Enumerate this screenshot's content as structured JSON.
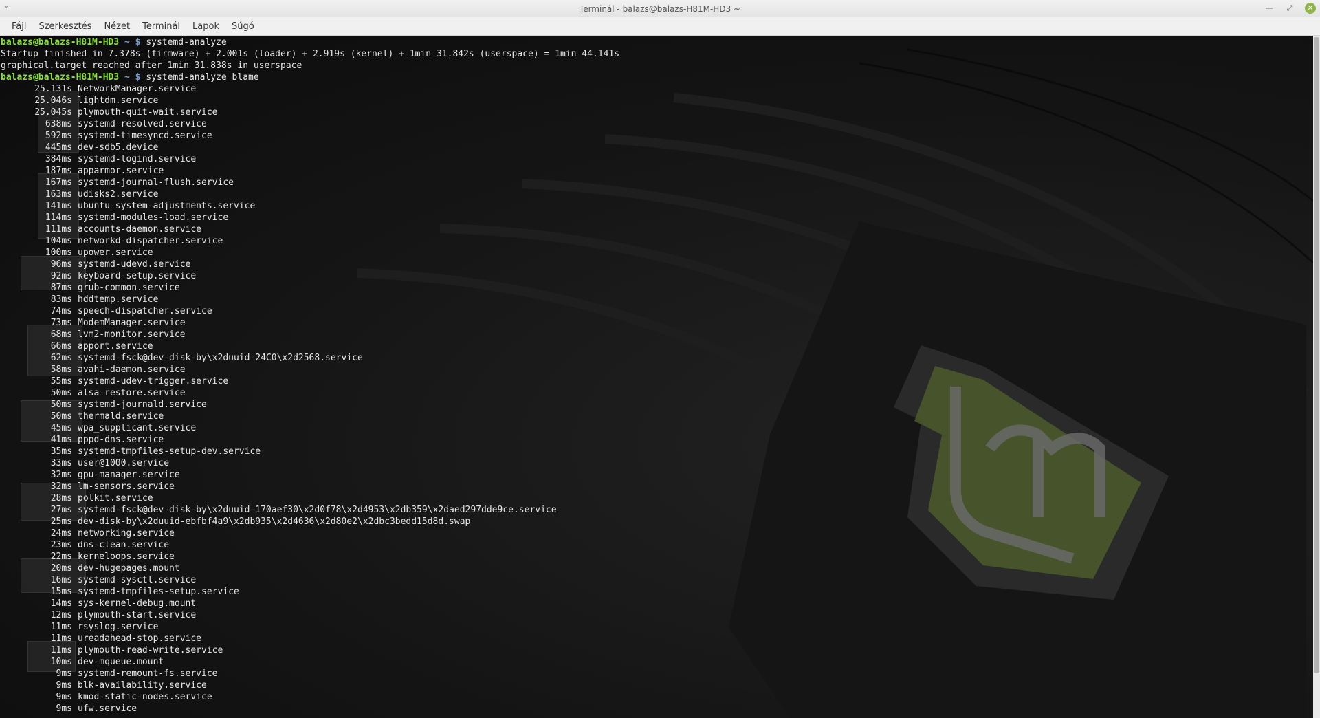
{
  "window": {
    "title": "Terminál - balazs@balazs-H81M-HD3 ~",
    "menu_toggle_icon": "chevron-down-icon",
    "controls": {
      "minimize_icon": "minimize-icon",
      "maximize_icon": "maximize-icon",
      "close_icon": "close-icon"
    }
  },
  "menu": [
    "Fájl",
    "Szerkesztés",
    "Nézet",
    "Terminál",
    "Lapok",
    "Súgó"
  ],
  "colors": {
    "prompt_user": "#8ae234",
    "prompt_path": "#729fcf",
    "text": "#e6e6e6",
    "close_button": "#8fb54a"
  },
  "terminal": {
    "commands": [
      {
        "user": "balazs@balazs-H81M-HD3",
        "path": "~ $",
        "cmd": "systemd-analyze"
      },
      {
        "user": "balazs@balazs-H81M-HD3",
        "path": "~ $",
        "cmd": "systemd-analyze blame"
      }
    ],
    "analyze_output": [
      "Startup finished in 7.378s (firmware) + 2.001s (loader) + 2.919s (kernel) + 1min 31.842s (userspace) = 1min 44.141s",
      "graphical.target reached after 1min 31.838s in userspace"
    ],
    "blame": [
      [
        "25.131s",
        "NetworkManager.service"
      ],
      [
        "25.046s",
        "lightdm.service"
      ],
      [
        "25.045s",
        "plymouth-quit-wait.service"
      ],
      [
        "638ms",
        "systemd-resolved.service"
      ],
      [
        "592ms",
        "systemd-timesyncd.service"
      ],
      [
        "445ms",
        "dev-sdb5.device"
      ],
      [
        "384ms",
        "systemd-logind.service"
      ],
      [
        "187ms",
        "apparmor.service"
      ],
      [
        "167ms",
        "systemd-journal-flush.service"
      ],
      [
        "163ms",
        "udisks2.service"
      ],
      [
        "141ms",
        "ubuntu-system-adjustments.service"
      ],
      [
        "114ms",
        "systemd-modules-load.service"
      ],
      [
        "111ms",
        "accounts-daemon.service"
      ],
      [
        "104ms",
        "networkd-dispatcher.service"
      ],
      [
        "100ms",
        "upower.service"
      ],
      [
        "96ms",
        "systemd-udevd.service"
      ],
      [
        "92ms",
        "keyboard-setup.service"
      ],
      [
        "87ms",
        "grub-common.service"
      ],
      [
        "83ms",
        "hddtemp.service"
      ],
      [
        "74ms",
        "speech-dispatcher.service"
      ],
      [
        "73ms",
        "ModemManager.service"
      ],
      [
        "68ms",
        "lvm2-monitor.service"
      ],
      [
        "66ms",
        "apport.service"
      ],
      [
        "62ms",
        "systemd-fsck@dev-disk-by\\x2duuid-24C0\\x2d2568.service"
      ],
      [
        "58ms",
        "avahi-daemon.service"
      ],
      [
        "55ms",
        "systemd-udev-trigger.service"
      ],
      [
        "50ms",
        "alsa-restore.service"
      ],
      [
        "50ms",
        "systemd-journald.service"
      ],
      [
        "50ms",
        "thermald.service"
      ],
      [
        "45ms",
        "wpa_supplicant.service"
      ],
      [
        "41ms",
        "pppd-dns.service"
      ],
      [
        "35ms",
        "systemd-tmpfiles-setup-dev.service"
      ],
      [
        "33ms",
        "user@1000.service"
      ],
      [
        "32ms",
        "gpu-manager.service"
      ],
      [
        "32ms",
        "lm-sensors.service"
      ],
      [
        "28ms",
        "polkit.service"
      ],
      [
        "27ms",
        "systemd-fsck@dev-disk-by\\x2duuid-170aef30\\x2d0f78\\x2d4953\\x2db359\\x2daed297dde9ce.service"
      ],
      [
        "25ms",
        "dev-disk-by\\x2duuid-ebfbf4a9\\x2db935\\x2d4636\\x2d80e2\\x2dbc3bedd15d8d.swap"
      ],
      [
        "24ms",
        "networking.service"
      ],
      [
        "23ms",
        "dns-clean.service"
      ],
      [
        "22ms",
        "kerneloops.service"
      ],
      [
        "20ms",
        "dev-hugepages.mount"
      ],
      [
        "16ms",
        "systemd-sysctl.service"
      ],
      [
        "15ms",
        "systemd-tmpfiles-setup.service"
      ],
      [
        "14ms",
        "sys-kernel-debug.mount"
      ],
      [
        "12ms",
        "plymouth-start.service"
      ],
      [
        "11ms",
        "rsyslog.service"
      ],
      [
        "11ms",
        "ureadahead-stop.service"
      ],
      [
        "11ms",
        "plymouth-read-write.service"
      ],
      [
        "10ms",
        "dev-mqueue.mount"
      ],
      [
        "9ms",
        "systemd-remount-fs.service"
      ],
      [
        "9ms",
        "blk-availability.service"
      ],
      [
        "9ms",
        "kmod-static-nodes.service"
      ],
      [
        "9ms",
        "ufw.service"
      ]
    ]
  }
}
